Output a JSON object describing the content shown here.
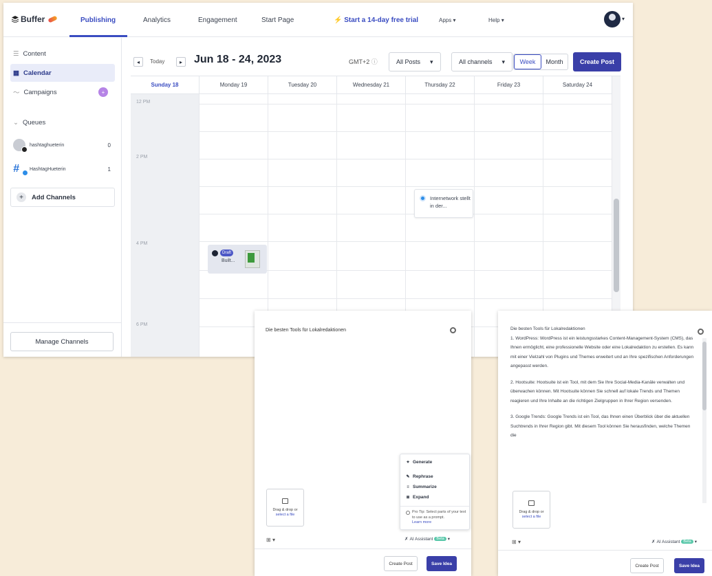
{
  "nav": {
    "logo": "Buffer",
    "tabs": [
      "Publishing",
      "Analytics",
      "Engagement",
      "Start Page"
    ],
    "trial": "Start a 14-day free trial",
    "apps": "Apps",
    "help": "Help"
  },
  "sidebar": {
    "content": "Content",
    "calendar": "Calendar",
    "campaigns": "Campaigns",
    "campaigns_badge": "+",
    "queues": "Queues",
    "channels": [
      {
        "name": "hashtaghueterin",
        "count": "0"
      },
      {
        "name": "HashtagHueterin",
        "count": "1"
      }
    ],
    "add_channels": "Add Channels",
    "manage_channels": "Manage Channels"
  },
  "toolbar": {
    "today": "Today",
    "date_range": "Jun 18 - 24, 2023",
    "timezone": "GMT+2",
    "posts_filter": "All Posts",
    "channels_filter": "All channels",
    "view_week": "Week",
    "view_month": "Month",
    "create_post": "Create Post"
  },
  "calendar": {
    "days": [
      "Sunday 18",
      "Monday 19",
      "Tuesday 20",
      "Wednesday 21",
      "Thursday 22",
      "Friday 23",
      "Saturday 24"
    ],
    "hours": [
      "12 PM",
      "2 PM",
      "4 PM",
      "6 PM"
    ],
    "draft_post": {
      "badge": "Draft",
      "text": "Built..."
    },
    "scheduled_post": {
      "text": "Internetwork stellt in der..."
    }
  },
  "dialog1": {
    "title": "Die besten Tools für Lokalredaktionen",
    "upload_text": "Drag & drop or",
    "upload_link": "select a file",
    "ai_menu": {
      "generate": "Generate",
      "rephrase": "Rephrase",
      "summarize": "Summarize",
      "expand": "Expand",
      "tip": "Pro Tip: Select parts of your text to use as a prompt.",
      "learn_more": "Learn more"
    },
    "ai_assistant": "AI Assistant",
    "beta": "Beta",
    "create_post": "Create Post",
    "save_idea": "Save Idea"
  },
  "dialog2": {
    "title": "Die besten Tools für Lokalredaktionen",
    "paragraphs": [
      "1. WordPress: WordPress ist ein leistungsstarkes Content-Management-System (CMS), das Ihnen ermöglicht, eine professionelle Website oder eine Lokalredaktion zu erstellen. Es kann mit einer Vielzahl von Plugins und Themes erweitert und an Ihre spezifischen Anforderungen angepasst werden.",
      "2. Hootsuite: Hootsuite ist ein Tool, mit dem Sie Ihre Social-Media-Kanäle verwalten und überwachen können. Mit Hootsuite können Sie schnell auf lokale Trends und Themen reagieren und Ihre Inhalte an die richtigen Zielgruppen in Ihrer Region versenden.",
      "3. Google Trends: Google Trends ist ein Tool, das Ihnen einen Überblick über die aktuellen Suchtrends in Ihrer Region gibt. Mit diesem Tool können Sie herausfinden, welche Themen die"
    ],
    "upload_text": "Drag & drop or",
    "upload_link": "select a file",
    "ai_assistant": "AI Assistant",
    "beta": "Beta",
    "create_post": "Create Post",
    "save_idea": "Save Idea"
  }
}
